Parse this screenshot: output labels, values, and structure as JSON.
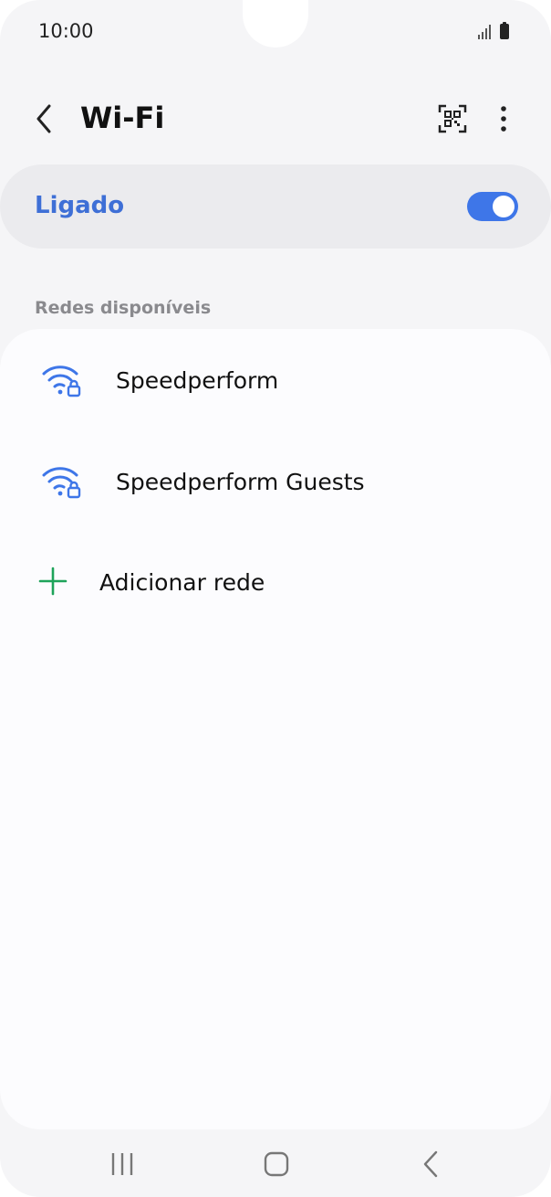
{
  "status_bar": {
    "time": "10:00"
  },
  "app_bar": {
    "title": "Wi-Fi"
  },
  "wifi_toggle": {
    "label": "Ligado",
    "on": true,
    "accent_color": "#3e76e8"
  },
  "networks_section": {
    "header": "Redes disponíveis",
    "networks": [
      {
        "name": "Speedperform",
        "secured": true
      },
      {
        "name": "Speedperform Guests",
        "secured": true
      }
    ],
    "add_network_label": "Adicionar rede"
  },
  "icons": {
    "back": "back-arrow-icon",
    "qr": "qr-code-scanner-icon",
    "more": "more-options-icon",
    "wifi": "wifi-lock-icon",
    "add": "plus-icon"
  }
}
